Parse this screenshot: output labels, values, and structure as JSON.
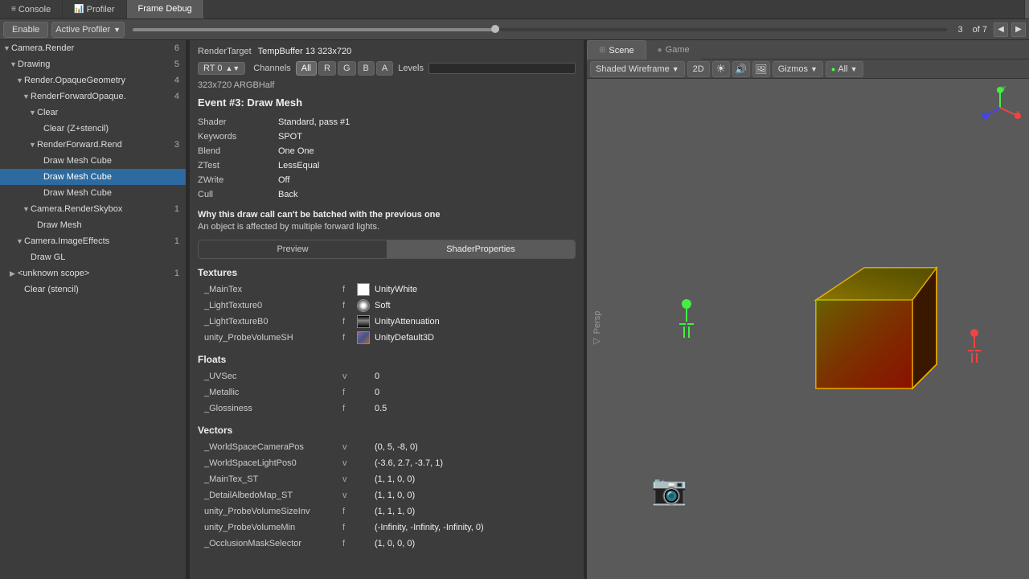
{
  "tabs": {
    "console": "Console",
    "profiler": "Profiler",
    "frameDebug": "Frame Debug"
  },
  "toolbar": {
    "enable": "Enable",
    "activeProfiler": "Active Profiler",
    "frameNum": "3",
    "frameOf": "of 7"
  },
  "renderTarget": {
    "label": "RenderTarget",
    "value": "TempBuffer 13 323x720",
    "rt": "RT 0",
    "channelsLabel": "Channels",
    "channels": [
      "All",
      "R",
      "G",
      "B",
      "A"
    ],
    "levels": "Levels",
    "format": "323x720 ARGBHalf"
  },
  "event": {
    "title": "Event #3: Draw Mesh",
    "shader_label": "Shader",
    "shader_val": "Standard, pass #1",
    "keywords_label": "Keywords",
    "keywords_val": "SPOT",
    "blend_label": "Blend",
    "blend_val": "One One",
    "ztest_label": "ZTest",
    "ztest_val": "LessEqual",
    "zwrite_label": "ZWrite",
    "zwrite_val": "Off",
    "cull_label": "Cull",
    "cull_val": "Back"
  },
  "batch": {
    "title": "Why this draw call can't be batched with the previous one",
    "reason": "An object is affected by multiple forward lights."
  },
  "viewTabs": {
    "preview": "Preview",
    "shaderProperties": "ShaderProperties"
  },
  "textures": {
    "title": "Textures",
    "items": [
      {
        "name": "_MainTex",
        "type": "f",
        "value": "UnityWhite",
        "texType": "white"
      },
      {
        "name": "_LightTexture0",
        "type": "f",
        "value": "Soft",
        "texType": "soft"
      },
      {
        "name": "_LightTextureB0",
        "type": "f",
        "value": "UnityAttenuation",
        "texType": "atten"
      },
      {
        "name": "unity_ProbeVolumeSH",
        "type": "f",
        "value": "UnityDefault3D",
        "texType": "3d"
      }
    ]
  },
  "floats": {
    "title": "Floats",
    "items": [
      {
        "name": "_UVSec",
        "type": "v",
        "value": "0"
      },
      {
        "name": "_Metallic",
        "type": "f",
        "value": "0"
      },
      {
        "name": "_Glossiness",
        "type": "f",
        "value": "0.5"
      }
    ]
  },
  "vectors": {
    "title": "Vectors",
    "items": [
      {
        "name": "_WorldSpaceCameraPos",
        "type": "v",
        "value": "(0, 5, -8, 0)"
      },
      {
        "name": "_WorldSpaceLightPos0",
        "type": "v",
        "value": "(-3.6, 2.7, -3.7, 1)"
      },
      {
        "name": "_MainTex_ST",
        "type": "v",
        "value": "(1, 1, 0, 0)"
      },
      {
        "name": "_DetailAlbedoMap_ST",
        "type": "v",
        "value": "(1, 1, 0, 0)"
      },
      {
        "name": "unity_ProbeVolumeSizeInv",
        "type": "f",
        "value": "(1, 1, 1, 0)"
      },
      {
        "name": "unity_ProbeVolumeMin",
        "type": "f",
        "value": "(-Infinity, -Infinity, -Infinity, 0)"
      },
      {
        "name": "_OcclusionMaskSelector",
        "type": "f",
        "value": "(1, 0, 0, 0)"
      }
    ]
  },
  "tree": [
    {
      "level": 0,
      "toggle": "▼",
      "label": "Camera.Render",
      "count": "6",
      "selected": false
    },
    {
      "level": 1,
      "toggle": "▼",
      "label": "Drawing",
      "count": "5",
      "selected": false
    },
    {
      "level": 2,
      "toggle": "▼",
      "label": "Render.OpaqueGeometry",
      "count": "4",
      "selected": false
    },
    {
      "level": 3,
      "toggle": "▼",
      "label": "RenderForwardOpaque.",
      "count": "4",
      "selected": false
    },
    {
      "level": 4,
      "toggle": "▼",
      "label": "Clear",
      "count": "",
      "selected": false
    },
    {
      "level": 5,
      "toggle": "",
      "label": "Clear (Z+stencil)",
      "count": "",
      "selected": false
    },
    {
      "level": 4,
      "toggle": "▼",
      "label": "RenderForward.Rend",
      "count": "3",
      "selected": false
    },
    {
      "level": 5,
      "toggle": "",
      "label": "Draw Mesh Cube",
      "count": "",
      "selected": false
    },
    {
      "level": 5,
      "toggle": "",
      "label": "Draw Mesh Cube",
      "count": "",
      "selected": true
    },
    {
      "level": 5,
      "toggle": "",
      "label": "Draw Mesh Cube",
      "count": "",
      "selected": false
    },
    {
      "level": 3,
      "toggle": "▼",
      "label": "Camera.RenderSkybox",
      "count": "1",
      "selected": false
    },
    {
      "level": 4,
      "toggle": "",
      "label": "Draw Mesh",
      "count": "",
      "selected": false
    },
    {
      "level": 2,
      "toggle": "▼",
      "label": "Camera.ImageEffects",
      "count": "1",
      "selected": false
    },
    {
      "level": 3,
      "toggle": "",
      "label": "Draw GL",
      "count": "",
      "selected": false
    },
    {
      "level": 1,
      "toggle": "▶",
      "label": "<unknown scope>",
      "count": "1",
      "selected": false
    },
    {
      "level": 2,
      "toggle": "",
      "label": "Clear (stencil)",
      "count": "",
      "selected": false
    }
  ],
  "scene": {
    "tab": "Scene",
    "gameTab": "Game",
    "shading": "Shaded Wireframe",
    "mode2D": "2D",
    "gizmosLabel": "Gizmos",
    "allLabel": "All"
  }
}
